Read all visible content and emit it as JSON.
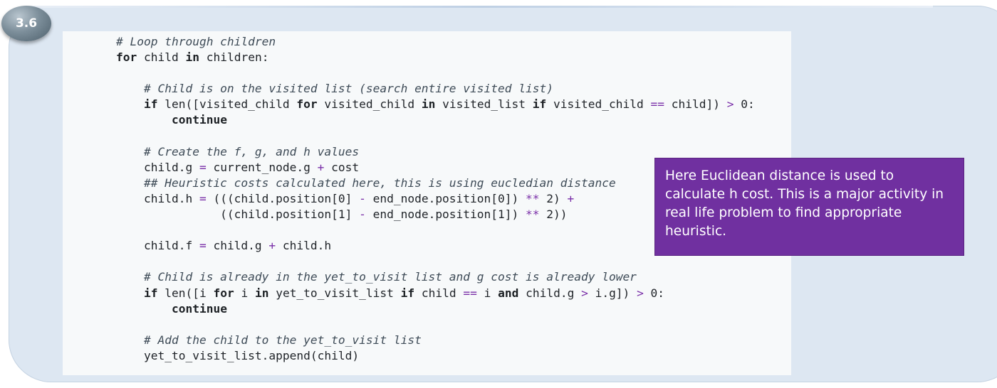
{
  "slide": {
    "number": "3.6"
  },
  "code": {
    "lines": [
      [
        [
          "c",
          "# Loop through children"
        ]
      ],
      [
        [
          "k",
          "for"
        ],
        [
          "p",
          " child "
        ],
        [
          "k",
          "in"
        ],
        [
          "p",
          " children:"
        ]
      ],
      [],
      [
        [
          "p",
          "    "
        ],
        [
          "c",
          "# Child is on the visited list (search entire visited list)"
        ]
      ],
      [
        [
          "p",
          "    "
        ],
        [
          "k",
          "if"
        ],
        [
          "p",
          " len([visited_child "
        ],
        [
          "k",
          "for"
        ],
        [
          "p",
          " visited_child "
        ],
        [
          "k",
          "in"
        ],
        [
          "p",
          " visited_list "
        ],
        [
          "k",
          "if"
        ],
        [
          "p",
          " visited_child "
        ],
        [
          "o",
          "=="
        ],
        [
          "p",
          " child]) "
        ],
        [
          "o",
          ">"
        ],
        [
          "p",
          " 0:"
        ]
      ],
      [
        [
          "p",
          "        "
        ],
        [
          "k",
          "continue"
        ]
      ],
      [],
      [
        [
          "p",
          "    "
        ],
        [
          "c",
          "# Create the f, g, and h values"
        ]
      ],
      [
        [
          "p",
          "    child.g "
        ],
        [
          "o",
          "="
        ],
        [
          "p",
          " current_node.g "
        ],
        [
          "o",
          "+"
        ],
        [
          "p",
          " cost"
        ]
      ],
      [
        [
          "p",
          "    "
        ],
        [
          "c",
          "## Heuristic costs calculated here, this is using eucledian distance"
        ]
      ],
      [
        [
          "p",
          "    child.h "
        ],
        [
          "o",
          "="
        ],
        [
          "p",
          " (((child.position[0] "
        ],
        [
          "o",
          "-"
        ],
        [
          "p",
          " end_node.position[0]) "
        ],
        [
          "o",
          "**"
        ],
        [
          "p",
          " 2) "
        ],
        [
          "o",
          "+"
        ]
      ],
      [
        [
          "p",
          "               ((child.position[1] "
        ],
        [
          "o",
          "-"
        ],
        [
          "p",
          " end_node.position[1]) "
        ],
        [
          "o",
          "**"
        ],
        [
          "p",
          " 2))"
        ]
      ],
      [],
      [
        [
          "p",
          "    child.f "
        ],
        [
          "o",
          "="
        ],
        [
          "p",
          " child.g "
        ],
        [
          "o",
          "+"
        ],
        [
          "p",
          " child.h"
        ]
      ],
      [],
      [
        [
          "p",
          "    "
        ],
        [
          "c",
          "# Child is already in the yet_to_visit list and g cost is already lower"
        ]
      ],
      [
        [
          "p",
          "    "
        ],
        [
          "k",
          "if"
        ],
        [
          "p",
          " len([i "
        ],
        [
          "k",
          "for"
        ],
        [
          "p",
          " i "
        ],
        [
          "k",
          "in"
        ],
        [
          "p",
          " yet_to_visit_list "
        ],
        [
          "k",
          "if"
        ],
        [
          "p",
          " child "
        ],
        [
          "o",
          "=="
        ],
        [
          "p",
          " i "
        ],
        [
          "k",
          "and"
        ],
        [
          "p",
          " child.g "
        ],
        [
          "o",
          ">"
        ],
        [
          "p",
          " i.g]) "
        ],
        [
          "o",
          ">"
        ],
        [
          "p",
          " 0:"
        ]
      ],
      [
        [
          "p",
          "        "
        ],
        [
          "k",
          "continue"
        ]
      ],
      [],
      [
        [
          "p",
          "    "
        ],
        [
          "c",
          "# Add the child to the yet_to_visit list"
        ]
      ],
      [
        [
          "p",
          "    yet_to_visit_list.append(child)"
        ]
      ]
    ]
  },
  "callout": {
    "text": "Here Euclidean distance is used to calculate h cost. This is a major activity in real life problem  to find appropriate heuristic.",
    "background": "#7030a0"
  },
  "colors": {
    "frame": "#dde7f2",
    "code_background": "#f7f9fa",
    "operator": "#7a2fa8",
    "badge": "#6d7f8b"
  }
}
